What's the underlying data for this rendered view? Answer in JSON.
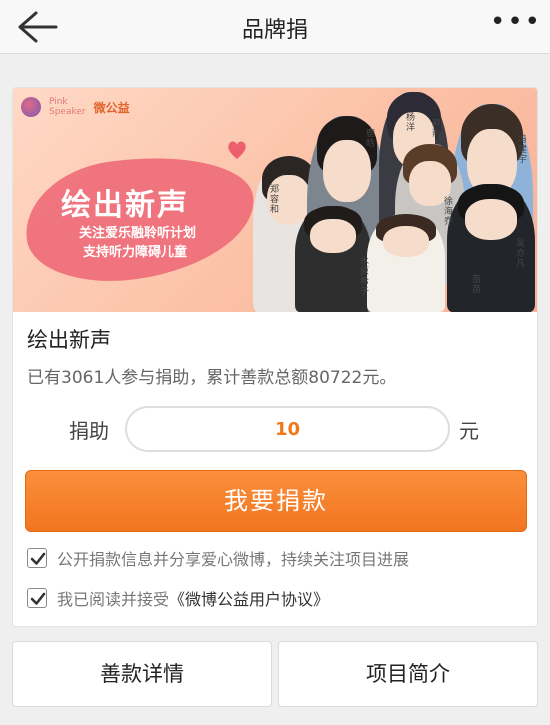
{
  "header": {
    "title": "品牌捐",
    "more_label": "•••"
  },
  "banner": {
    "title": "绘出新声",
    "subtitle_1": "关注爱乐融聆听计划",
    "subtitle_2": "支持听力障碍儿童",
    "logo_weibo": "微公益",
    "celebrity_names": [
      "郑容和",
      "鹿晗",
      "杨洋",
      "冯建宇",
      "赖雨",
      "徐海乔",
      "水原希子",
      "吴亦凡",
      "苗苗"
    ]
  },
  "project": {
    "title": "绘出新声",
    "stats": "已有3061人参与捐助，累计善款总额80722元。"
  },
  "donation": {
    "label": "捐助",
    "amount": "10",
    "unit": "元",
    "button_label": "我要捐款"
  },
  "agreements": {
    "share_text": "公开捐款信息并分享爱心微博，持续关注项目进展",
    "share_checked": true,
    "terms_prefix": "我已阅读并接受",
    "terms_link": "《微博公益用户协议》",
    "terms_checked": true
  },
  "tabs": {
    "details_label": "善款详情",
    "intro_label": "项目简介"
  },
  "colors": {
    "accent": "#f27520",
    "amount_text": "#f07a1a",
    "banner_brush": "#ef6c78"
  }
}
